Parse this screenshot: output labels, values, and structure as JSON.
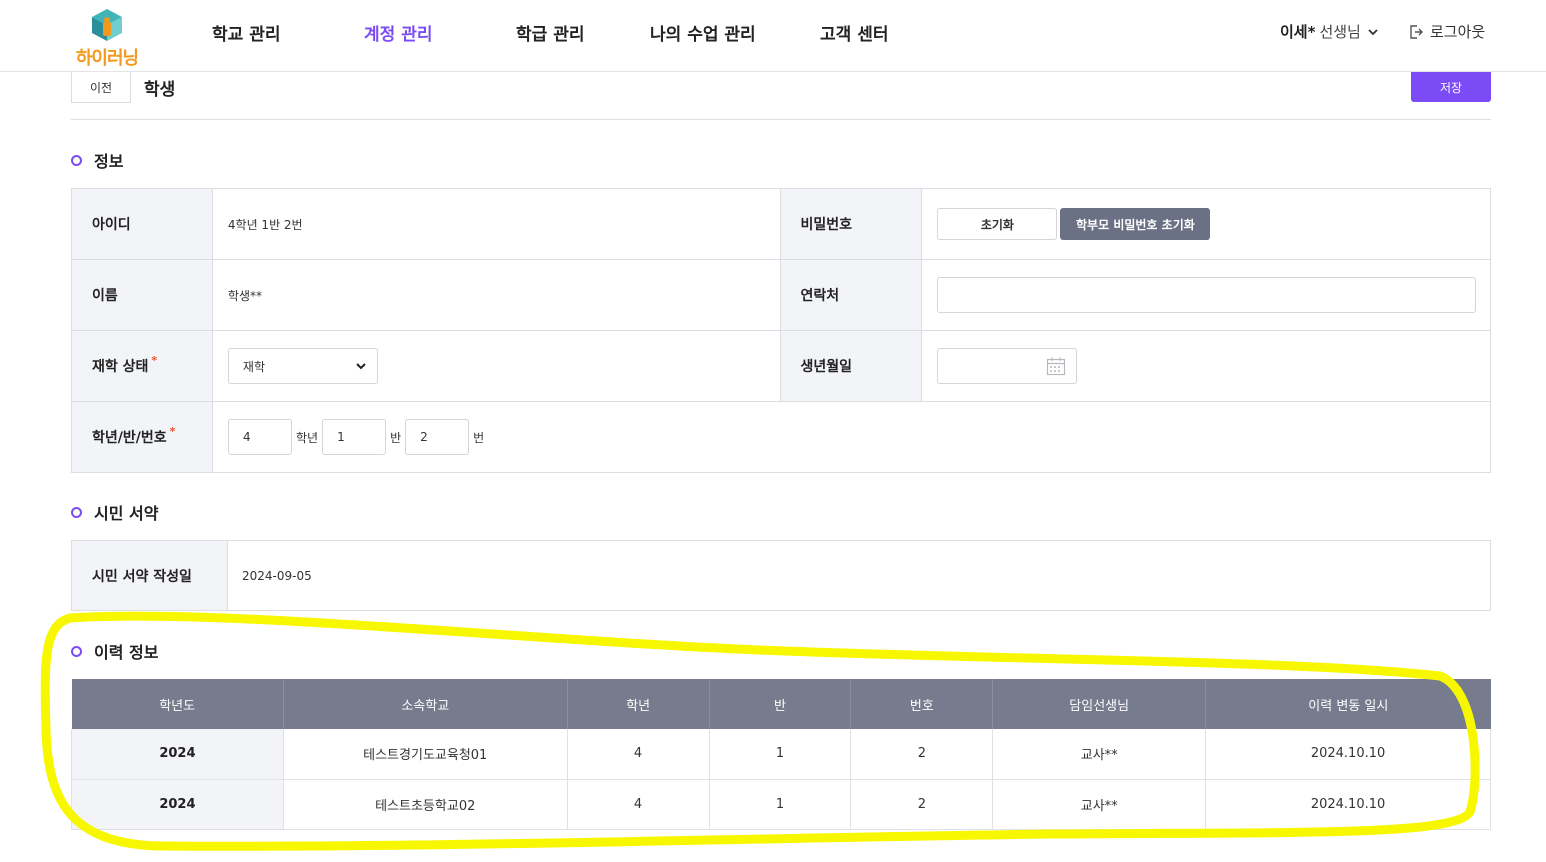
{
  "brand": {
    "logo_text": "하이러닝",
    "accent_color": "#7b4cf5",
    "logo_color": "#f39a1e"
  },
  "nav": {
    "items": [
      {
        "label": "학교 관리",
        "active": false
      },
      {
        "label": "계정 관리",
        "active": true
      },
      {
        "label": "학급 관리",
        "active": false
      },
      {
        "label": "나의 수업 관리",
        "active": false
      },
      {
        "label": "고객 센터",
        "active": false
      }
    ]
  },
  "user": {
    "name": "이세*",
    "role": "선생님",
    "logout_label": "로그아웃"
  },
  "page": {
    "prev_label": "이전",
    "title": "학생",
    "save_label": "저장"
  },
  "info": {
    "section_title": "정보",
    "id_label": "아이디",
    "id_value": "4학년 1반 2번",
    "password_label": "비밀번호",
    "reset_label": "초기화",
    "parent_reset_label": "학부모 비밀번호 초기화",
    "name_label": "이름",
    "name_value": "학생**",
    "contact_label": "연락처",
    "contact_value": "",
    "status_label": "재학 상태",
    "status_value": "재학",
    "birth_label": "생년월일",
    "birth_value": "",
    "grade_class_label": "학년/반/번호",
    "grade_value": "4",
    "grade_unit": "학년",
    "class_value": "1",
    "class_unit": "반",
    "number_value": "2",
    "number_unit": "번",
    "required_mark": "*"
  },
  "pledge": {
    "section_title": "시민 서약",
    "date_label": "시민 서약 작성일",
    "date_value": "2024-09-05"
  },
  "history": {
    "section_title": "이력 정보",
    "columns": [
      "학년도",
      "소속학교",
      "학년",
      "반",
      "번호",
      "담임선생님",
      "이력 변동 일시"
    ],
    "rows": [
      [
        "2024",
        "테스트경기도교육청01",
        "4",
        "1",
        "2",
        "교사**",
        "2024.10.10"
      ],
      [
        "2024",
        "테스트초등학교02",
        "4",
        "1",
        "2",
        "교사**",
        "2024.10.10"
      ]
    ],
    "highlight_color": "#f7f700"
  }
}
